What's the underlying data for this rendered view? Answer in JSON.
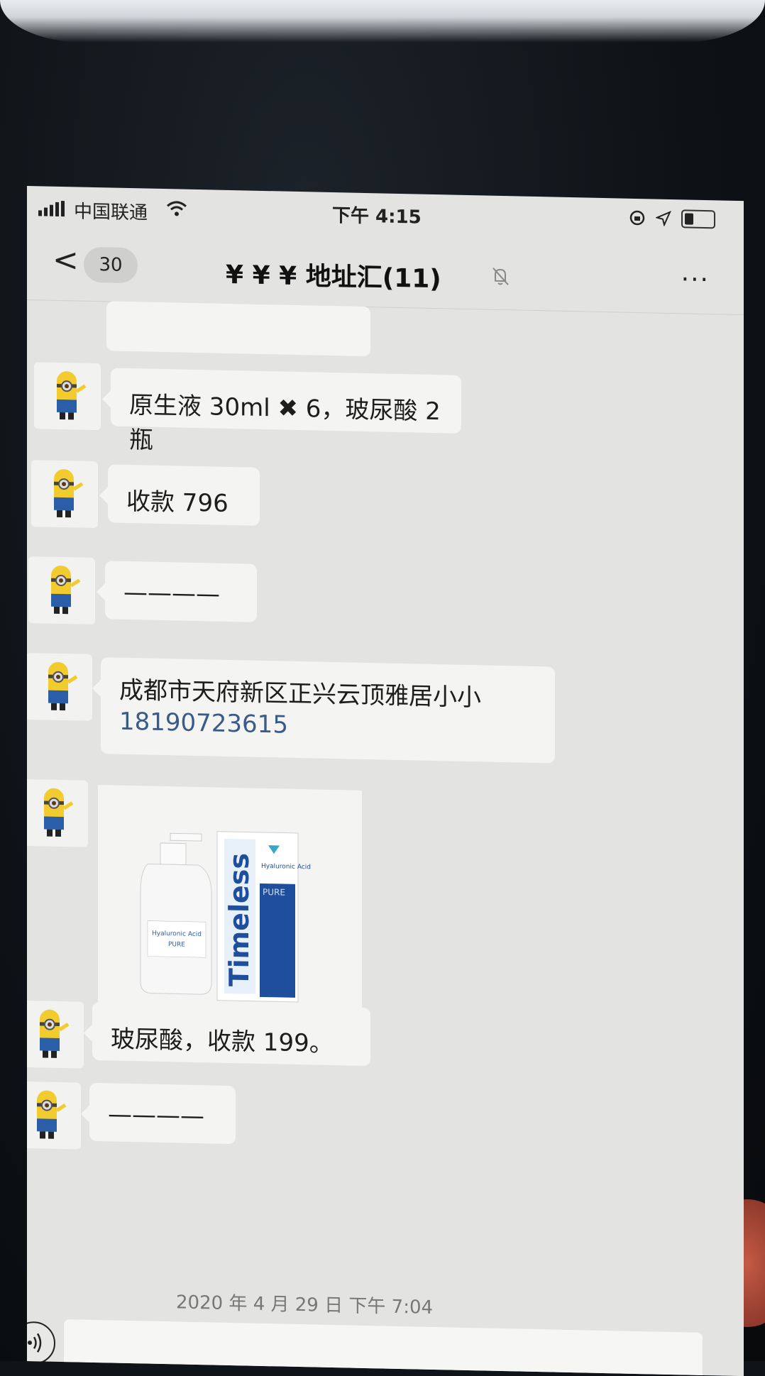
{
  "status_bar": {
    "carrier": "中国联通",
    "time": "下午 4:15"
  },
  "nav": {
    "back_label": "<",
    "unread_count": "30",
    "title": "¥ ¥ ¥ 地址汇(11)",
    "more_label": "..."
  },
  "messages": [
    {
      "type": "text",
      "text": "原生液 30ml ✖ 6，玻尿酸 2 瓶"
    },
    {
      "type": "text",
      "text": "收款 796"
    },
    {
      "type": "text",
      "text": "————"
    },
    {
      "type": "text",
      "line1": "成都市天府新区正兴云顶雅居小小",
      "phone": "18190723615"
    },
    {
      "type": "image",
      "product": {
        "brand": "Timeless",
        "bottle_label": "Hyaluronic Acid",
        "bottle_sub": "PURE",
        "box_label": "Hyaluronic Acid",
        "box_sub": "PURE"
      }
    },
    {
      "type": "text",
      "text": "玻尿酸，收款 199。"
    },
    {
      "type": "text",
      "text": "————"
    }
  ],
  "timestamp": "2020 年 4 月 29 日 下午 7:04",
  "colors": {
    "screen_bg": "#e3e3e1",
    "bubble_bg": "#f4f4f2",
    "phone_link": "#3a5a8a",
    "brand_blue": "#1f4e9c"
  }
}
